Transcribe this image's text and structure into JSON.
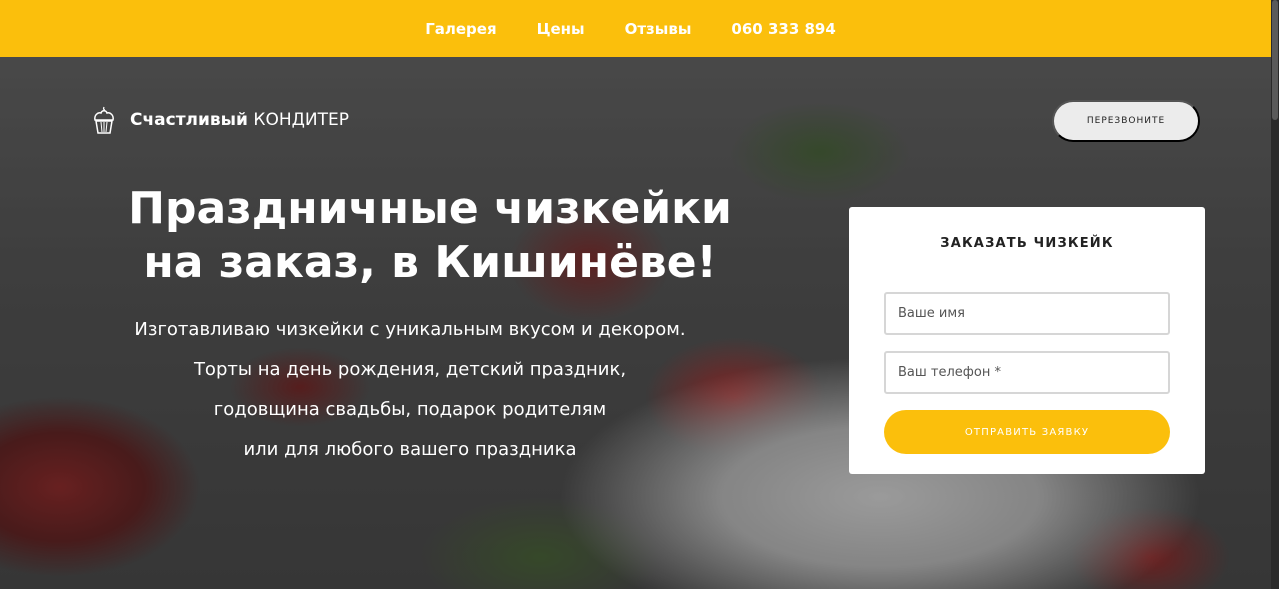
{
  "nav": {
    "items": [
      {
        "label": "Галерея"
      },
      {
        "label": "Цены"
      },
      {
        "label": "Отзывы"
      },
      {
        "label": "060 333 894"
      }
    ]
  },
  "logo": {
    "bold": "Счастливый",
    "light": "КОНДИТЕР"
  },
  "header": {
    "callback_label": "ПЕРЕЗВОНИТЕ"
  },
  "hero": {
    "headline_line1": "Праздничные чизкейки",
    "headline_line2": "на заказ, в Кишинёве!",
    "desc_lines": [
      "Изготавливаю чизкейки с уникальным вкусом и декором.",
      "Торты на день рождения, детский праздник,",
      "годовщина свадьбы, подарок родителям",
      "или для любого вашего праздника"
    ]
  },
  "form": {
    "title": "ЗАКАЗАТЬ ЧИЗКЕЙК",
    "name_placeholder": "Ваше имя",
    "phone_placeholder": "Ваш телефон *",
    "submit_label": "ОТПРАВИТЬ ЗАЯВКУ"
  },
  "colors": {
    "accent": "#fbbf0c",
    "card": "#ffffff"
  }
}
